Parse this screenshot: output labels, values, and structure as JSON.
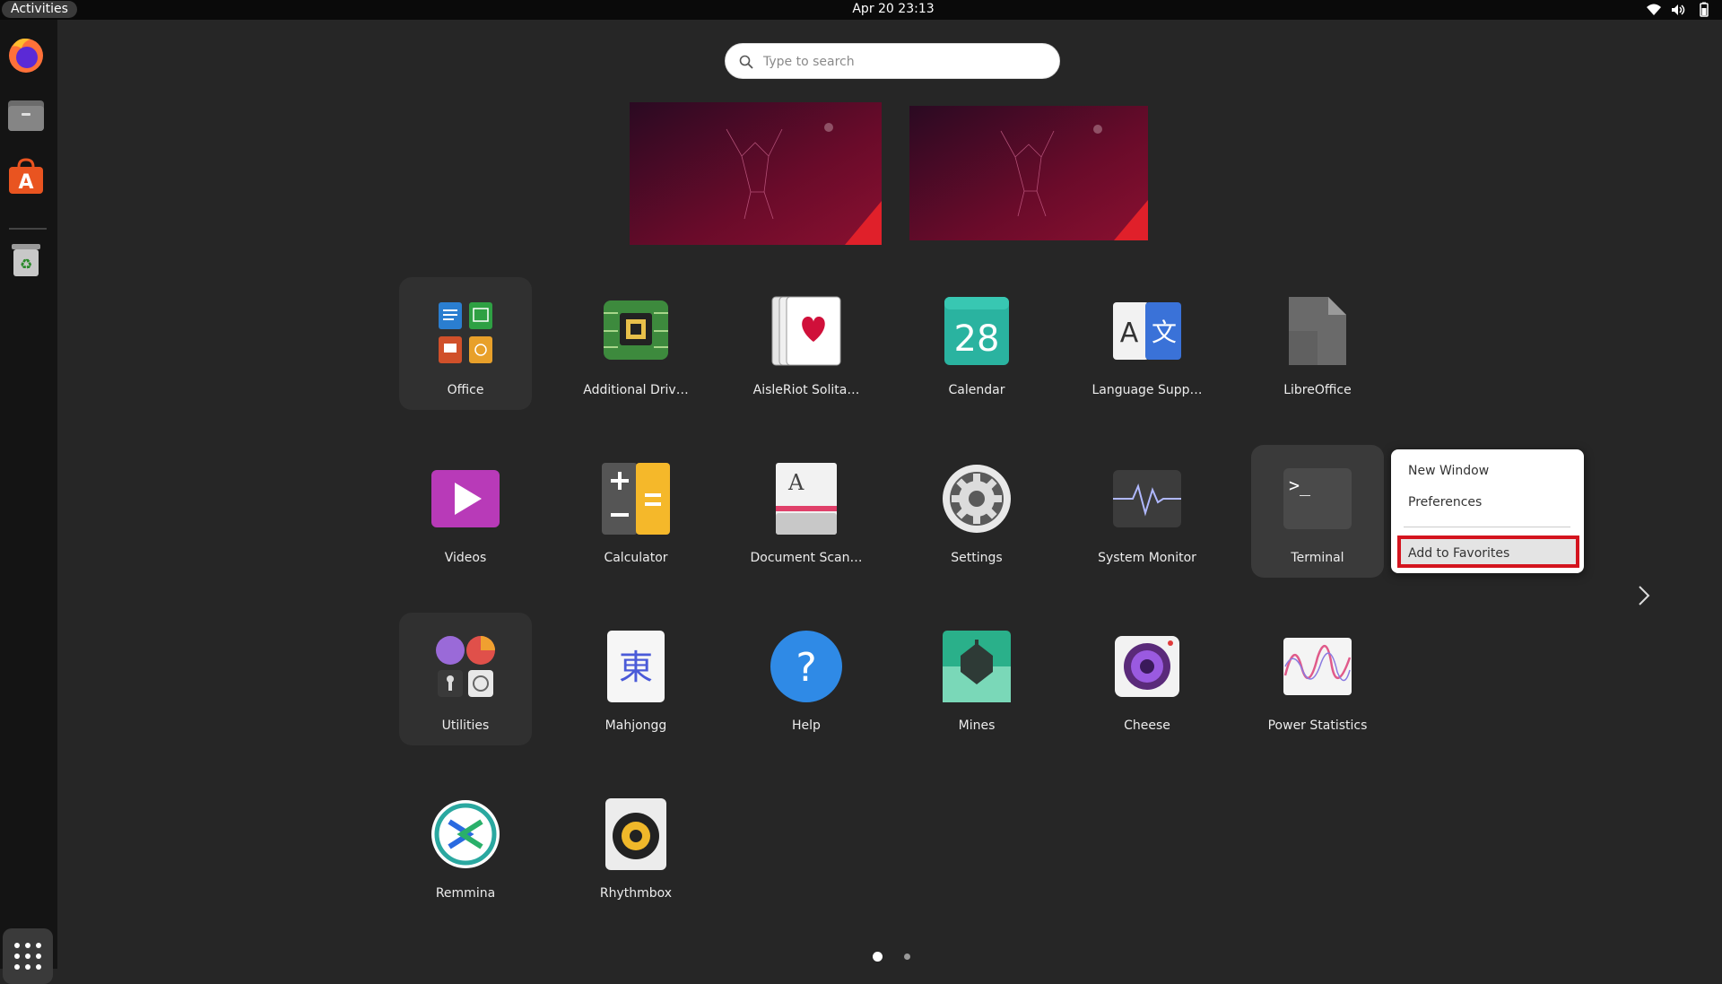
{
  "topbar": {
    "activities": "Activities",
    "clock": "Apr 20  23:13"
  },
  "dock": {
    "items": [
      "firefox-icon",
      "files-icon",
      "app-center-icon",
      "trash-icon"
    ],
    "show_apps": "grid-icon"
  },
  "search": {
    "placeholder": "Type to search"
  },
  "apps": [
    {
      "label": "Office"
    },
    {
      "label": "Additional Driv…"
    },
    {
      "label": "AisleRiot Solita…"
    },
    {
      "label": "Calendar",
      "icon_text": "28"
    },
    {
      "label": "Language Supp…",
      "icon_text_a": "A",
      "icon_text_b": "文"
    },
    {
      "label": "LibreOffice"
    },
    {
      "label": "Videos"
    },
    {
      "label": "Calculator"
    },
    {
      "label": "Document Scan…",
      "icon_text": "A"
    },
    {
      "label": "Settings"
    },
    {
      "label": "System Monitor"
    },
    {
      "label": "Terminal",
      "icon_text": ">_"
    },
    {
      "label": "Utilities"
    },
    {
      "label": "Mahjongg",
      "icon_text": "東"
    },
    {
      "label": "Help",
      "icon_text": "?"
    },
    {
      "label": "Mines"
    },
    {
      "label": "Cheese"
    },
    {
      "label": "Power Statistics"
    },
    {
      "label": "Remmina"
    },
    {
      "label": "Rhythmbox"
    }
  ],
  "context_menu": {
    "items": [
      "New Window",
      "Preferences",
      "Add to Favorites"
    ]
  },
  "pages": {
    "current": 1,
    "total": 2
  },
  "colors": {
    "accent": "#d4141e",
    "background": "#262626",
    "dock": "#141414"
  }
}
